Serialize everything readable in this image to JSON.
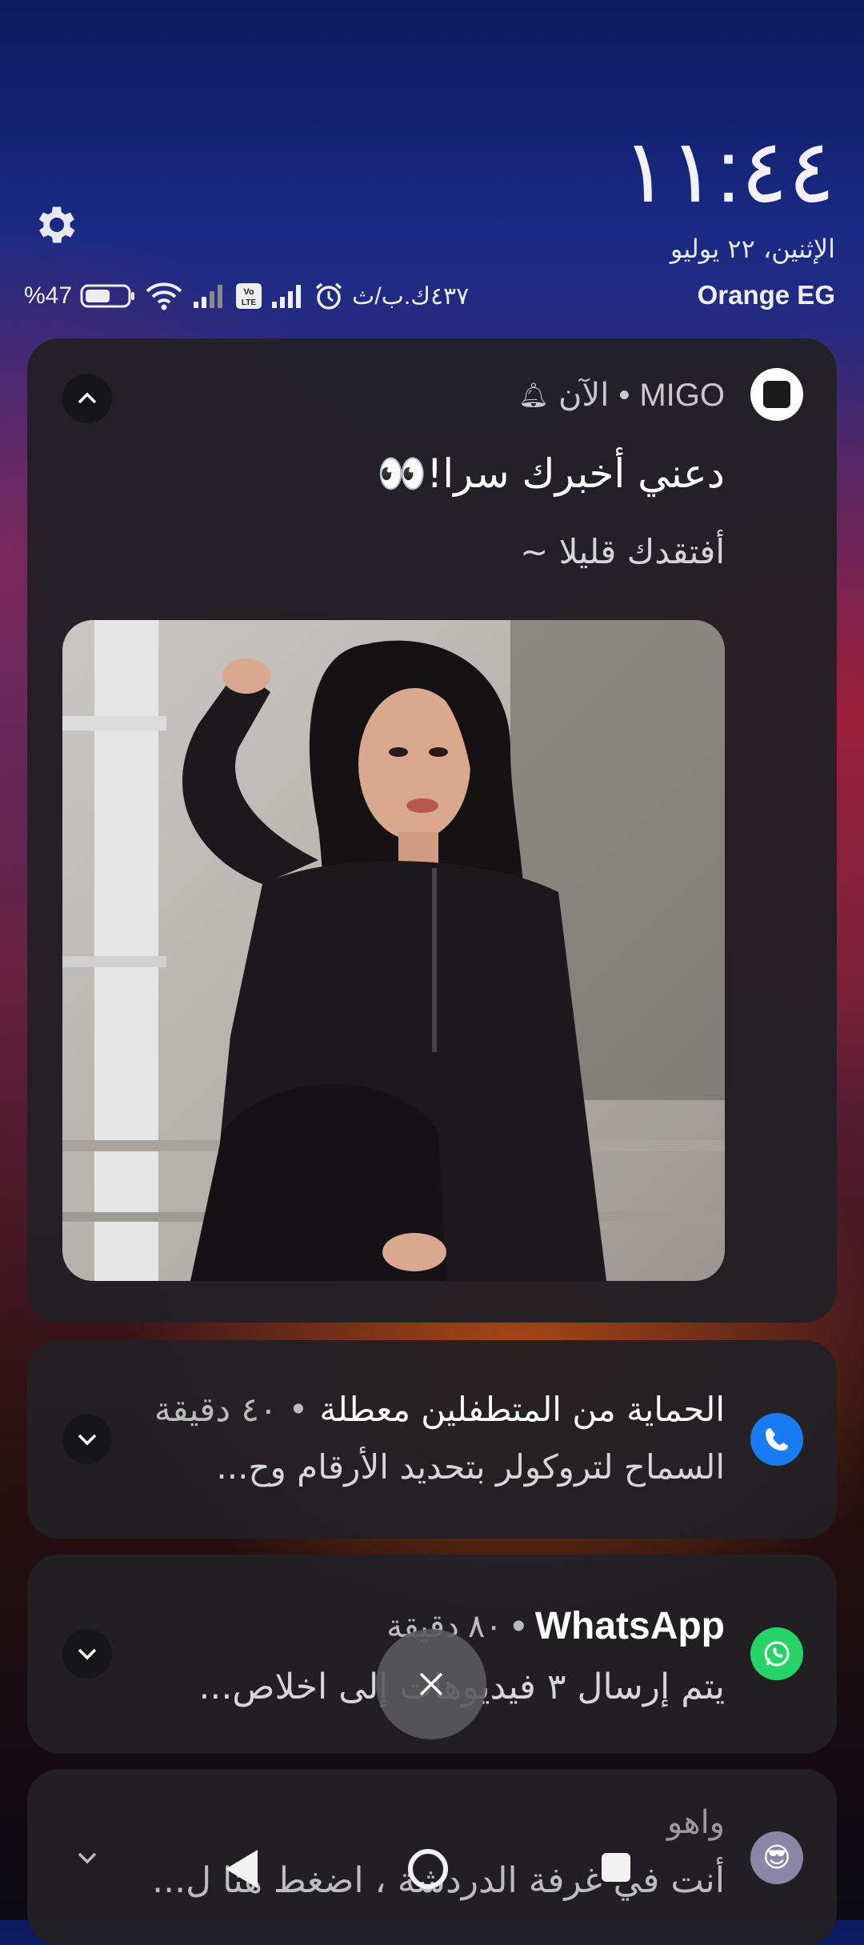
{
  "lockscreen": {
    "time": "١١:٤٤",
    "date": "الإثنين، ٢٢ يوليو",
    "carrier": "Orange EG"
  },
  "status_bar": {
    "battery_percent": "%47",
    "network_speed": "٤٣٧ك.ب/ث",
    "icons": [
      "wifi-icon",
      "signal-icon",
      "volte-icon",
      "signal-icon",
      "alarm-icon"
    ]
  },
  "notifications": [
    {
      "app": "MIGO",
      "time": "الآن",
      "title": "دعني أخبرك سرا!👀",
      "text": "أفتقدك قليلا ~",
      "expanded": true,
      "icon": "migo-icon"
    },
    {
      "title": "الحماية من المتطفلين معطلة",
      "time": "٤٠ دقيقة",
      "text": "السماح لتروكولر بتحديد الأرقام وح...",
      "icon": "truecaller-icon",
      "accent": "#1a7cf5"
    },
    {
      "app": "WhatsApp",
      "time": "٨٠ دقيقة",
      "text": "يتم إرسال ٣ فيديوهات إلى اخلاص...",
      "icon": "whatsapp-icon",
      "accent": "#25d366"
    },
    {
      "app": "واهو",
      "text": "أنت في غرفة الدردشة ، اضغط هنا ل...",
      "icon": "waho-icon"
    }
  ],
  "colors": {
    "card_bg": "#222024",
    "whatsapp": "#25d366",
    "truecaller": "#1a7cf5"
  }
}
